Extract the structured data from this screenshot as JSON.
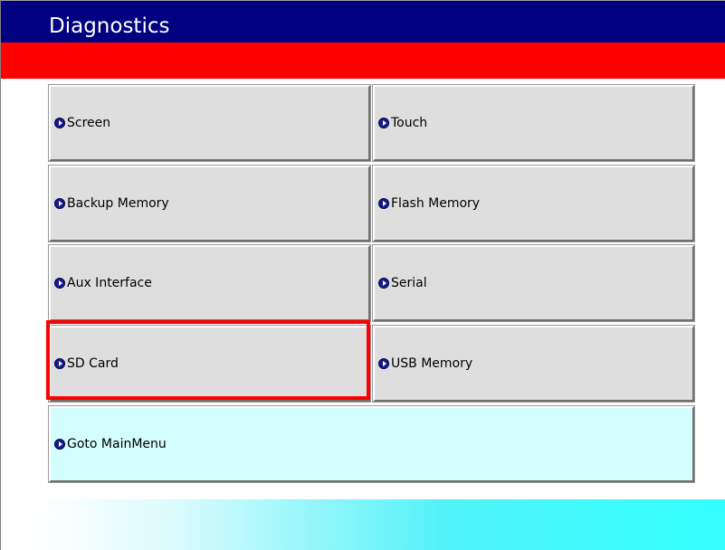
{
  "header": {
    "title": "Diagnostics",
    "bg_color": "#000080",
    "accent_bar_color": "#ff0000"
  },
  "menu": {
    "icon": "circle-arrow-right-icon",
    "items": [
      {
        "label": "Screen"
      },
      {
        "label": "Touch"
      },
      {
        "label": "Backup Memory"
      },
      {
        "label": "Flash Memory"
      },
      {
        "label": "Aux Interface"
      },
      {
        "label": "Serial"
      },
      {
        "label": "SD Card",
        "selected": true
      },
      {
        "label": "USB Memory"
      }
    ],
    "main_menu": {
      "label": "Goto MainMenu"
    },
    "selection_color": "#ff0000"
  },
  "footer": {
    "gradient_colors": [
      "#ffffff",
      "#33ffff"
    ]
  }
}
